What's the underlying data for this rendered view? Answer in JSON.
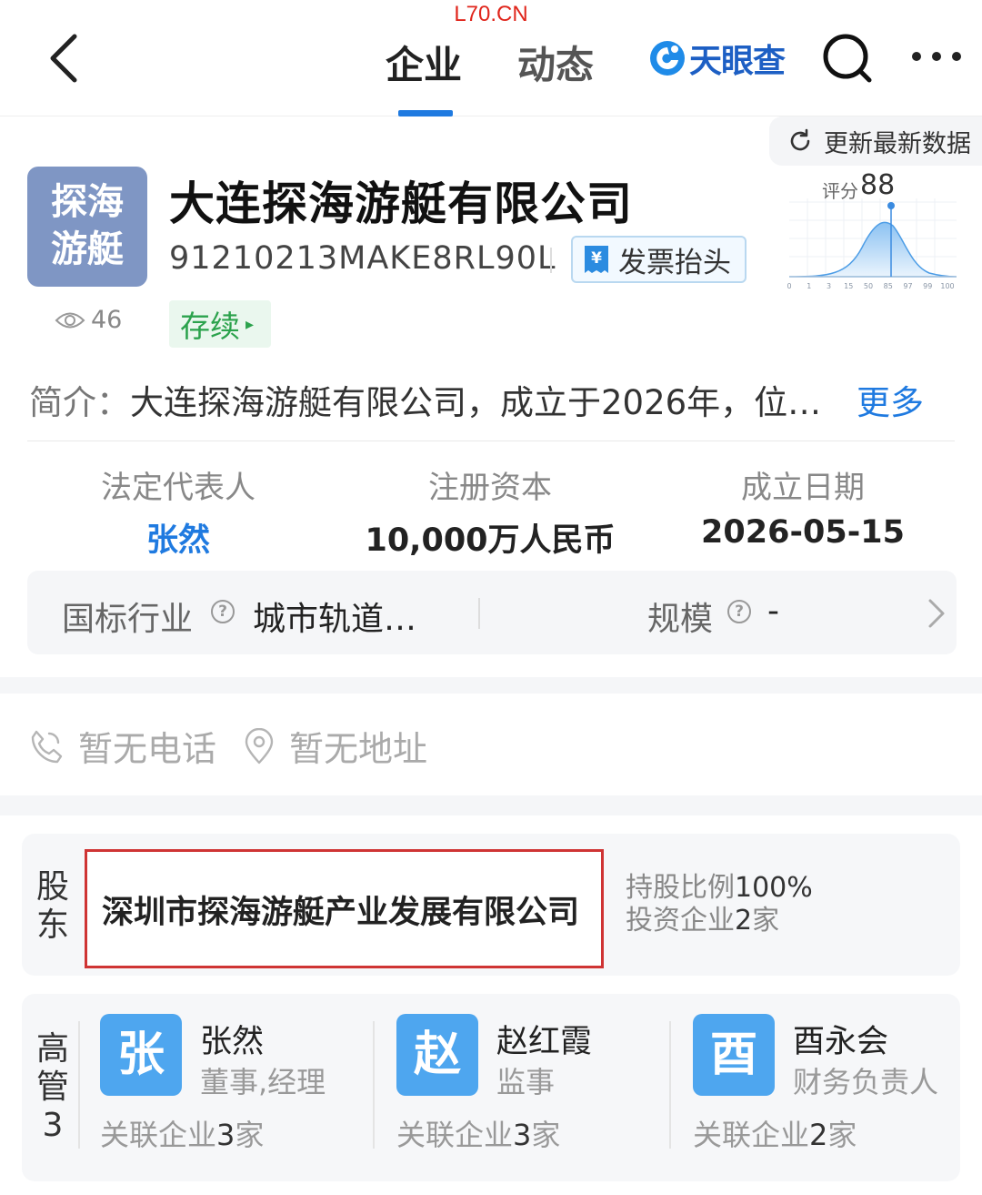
{
  "watermark": "L70.CN",
  "nav": {
    "tabs": [
      "企业",
      "动态"
    ],
    "active_tab": "企业",
    "brand": "天眼查",
    "accent_color": "#1f7ae0"
  },
  "refresh_label": "更新最新数据",
  "company": {
    "logo_text": [
      "探海",
      "游艇"
    ],
    "name": "大连探海游艇有限公司",
    "credit_code": "91210213MAKE8RL90L",
    "invoice_label": "发票抬头",
    "views": "46",
    "status": "存续"
  },
  "score": {
    "label": "评分",
    "value": "88",
    "axis_ticks": [
      "0",
      "1",
      "3",
      "15",
      "50",
      "85",
      "97",
      "99",
      "100"
    ]
  },
  "intro": {
    "label": "简介：",
    "text": "大连探海游艇有限公司，成立于2026年，位…",
    "more": "更多"
  },
  "facts": [
    {
      "label": "法定代表人",
      "value": "张然"
    },
    {
      "label": "注册资本",
      "value": "10,000万人民币"
    },
    {
      "label": "成立日期",
      "value": "2026-05-15"
    }
  ],
  "industry": {
    "label": "国标行业",
    "value": "城市轨道…",
    "scale_label": "规模",
    "scale_value": "-"
  },
  "contact": {
    "phone": "暂无电话",
    "address": "暂无地址"
  },
  "shareholder": {
    "section_label": [
      "股",
      "东"
    ],
    "name": "深圳市探海游艇产业发展有限公司",
    "ratio_label": "持股比例",
    "ratio": "100%",
    "invest_label": "投资企业",
    "invest_count": "2",
    "invest_unit": "家"
  },
  "executives": {
    "section_label": [
      "高",
      "管",
      "3"
    ],
    "related_label": "关联企业",
    "unit": "家",
    "items": [
      {
        "avatar": "张",
        "name": "张然",
        "role": "董事,经理",
        "related": "3"
      },
      {
        "avatar": "赵",
        "name": "赵红霞",
        "role": "监事",
        "related": "3"
      },
      {
        "avatar": "酉",
        "name": "酉永会",
        "role": "财务负责人",
        "related": "2"
      }
    ]
  }
}
